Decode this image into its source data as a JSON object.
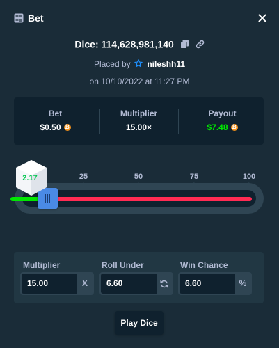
{
  "header": {
    "title": "Bet",
    "icon": "bet-slip-icon",
    "close_icon": "close-icon"
  },
  "info": {
    "game_id": "Dice: 114,628,981,140",
    "placed_by_prefix": "Placed by",
    "username": "nileshh11",
    "date": "on 10/10/2022 at 11:27 PM"
  },
  "stats": {
    "bet_label": "Bet",
    "bet_value": "$0.50",
    "multiplier_label": "Multiplier",
    "multiplier_value": "15.00×",
    "payout_label": "Payout",
    "payout_value": "$7.48",
    "currency_icon": "bitcoin-icon"
  },
  "slider": {
    "ticks": [
      "25",
      "50",
      "75",
      "100"
    ],
    "result": "2.17",
    "roll_under_value": 6.6,
    "colors": {
      "win": "#00e701",
      "lose": "#ff2b53",
      "handle": "#4a8ae5"
    }
  },
  "controls": {
    "multiplier_label": "Multiplier",
    "multiplier_value": "15.00",
    "multiplier_suffix": "X",
    "roll_under_label": "Roll Under",
    "roll_under_value": "6.60",
    "roll_under_icon": "refresh-icon",
    "win_chance_label": "Win Chance",
    "win_chance_value": "6.60",
    "win_chance_suffix": "%"
  },
  "play_button": "Play Dice",
  "colors": {
    "background": "#1a2c38",
    "panel_dark": "#0f212e",
    "panel_mid": "#213743",
    "border": "#2f4553",
    "muted_text": "#b1bad3",
    "win_green": "#00e701"
  }
}
